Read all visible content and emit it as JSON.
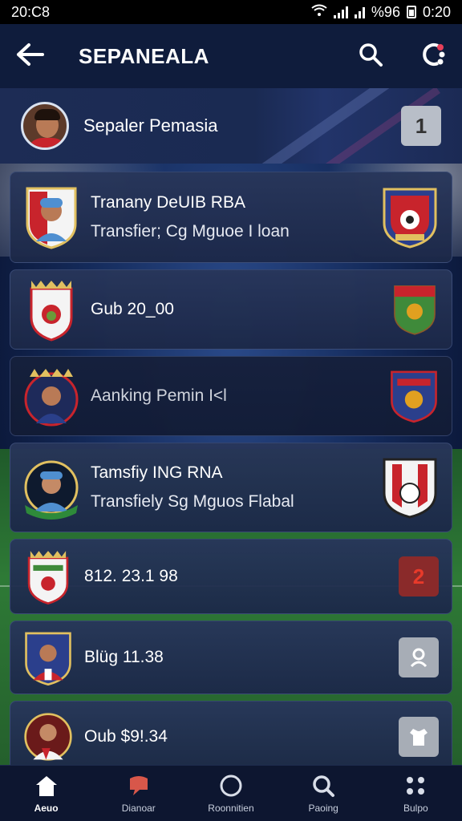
{
  "status_bar": {
    "time_left": "20:C8",
    "battery": "0:20",
    "signal_text": "%96"
  },
  "header": {
    "title": "SEPANEALA",
    "back_icon": "arrow-left-icon",
    "search_icon": "search-icon",
    "menu_icon": "network-icon"
  },
  "profile": {
    "name": "Sepaler Pemasia",
    "badge": "1"
  },
  "list": [
    {
      "line1": "Tranany DeUIB RBA",
      "line2": "Transfier; Cg Mguoe I loan"
    },
    {
      "line1": "Gub 20_00",
      "line2": ""
    },
    {
      "line1": "Aanking Pemin I<l",
      "line2": ""
    },
    {
      "line1": "Tamsfiy ING RNA",
      "line2": "Transfiely Sg Mguos Flabal"
    },
    {
      "line1": "812. 23.1 98",
      "line2": "",
      "badge": "2"
    },
    {
      "line1": "Blüg 11.38",
      "line2": ""
    },
    {
      "line1": "Oub $9!.34",
      "line2": ""
    }
  ],
  "nav": [
    {
      "label": "Aeuo",
      "icon": "home-icon"
    },
    {
      "label": "Dianoar",
      "icon": "chat-icon"
    },
    {
      "label": "Roonnitien",
      "icon": "circle-icon"
    },
    {
      "label": "Paoing",
      "icon": "search-icon"
    },
    {
      "label": "Bulpo",
      "icon": "grid-icon"
    }
  ],
  "colors": {
    "background": "#0d1a3a",
    "card": "#25345e",
    "accent_red": "#c8242c",
    "crest_blue": "#2b3f8c"
  }
}
